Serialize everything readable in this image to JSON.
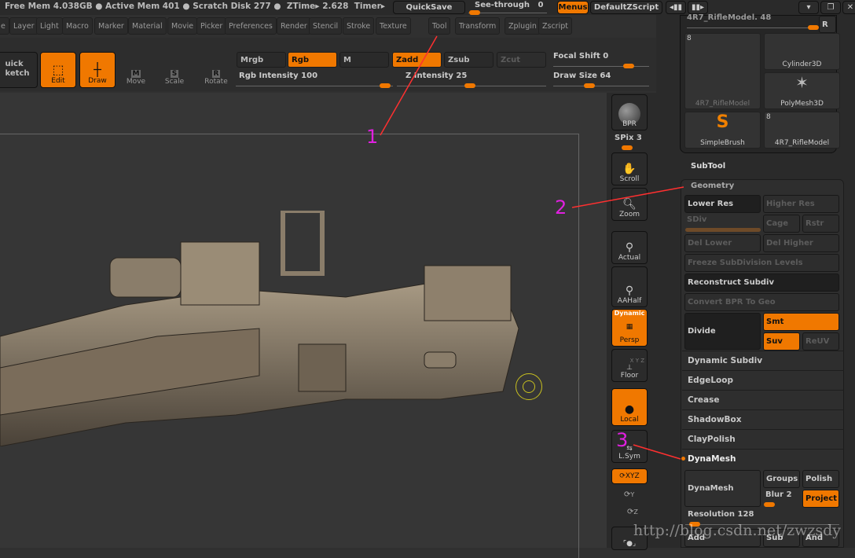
{
  "topbar": {
    "status": "Free Mem 4.038GB ● Active Mem 401 ● Scratch Disk 277 ●  ZTime▸ 2.628  Timer▸",
    "quicksave": "QuickSave",
    "see_through_label": "See-through",
    "see_through_value": "0",
    "menus": "Menus",
    "default_zscript": "DefaultZScript"
  },
  "menus": [
    "e",
    "Layer",
    "Light",
    "Macro",
    "Marker",
    "Material",
    "Movie",
    "Picker",
    "Preferences",
    "Render",
    "Stencil",
    "Stroke",
    "Texture",
    "Tool",
    "Transform",
    "Zplugin",
    "Zscript"
  ],
  "toolbar": {
    "quick_sketch": "uick\nketch",
    "edit": "Edit",
    "draw": "Draw",
    "move": "Move",
    "scale": "Scale",
    "rotate": "Rotate",
    "mrgb": "Mrgb",
    "rgb": "Rgb",
    "m": "M",
    "zadd": "Zadd",
    "zsub": "Zsub",
    "zcut": "Zcut",
    "rgb_intensity": "Rgb Intensity 100",
    "z_intensity": "Z Intensity 25",
    "focal_shift": "Focal Shift 0",
    "draw_size": "Draw Size 64",
    "rgb_intensity_value": 100,
    "z_intensity_value": 25,
    "draw_size_value": 64
  },
  "shelf": {
    "bpr": "BPR",
    "spix": "SPix 3",
    "scroll": "Scroll",
    "zoom": "Zoom",
    "actual": "Actual",
    "aahalf": "AAHalf",
    "dynamic": "Dynamic",
    "persp": "Persp",
    "floor": "Floor",
    "floor_axes": "X Y Z",
    "local": "Local",
    "lsym": "L.Sym",
    "xyz": "XYZ",
    "y": "Y",
    "z": "Z"
  },
  "tool_panel": {
    "model_slider": "4R7_RifleModel. 48",
    "r": "R",
    "thumbs": [
      {
        "label": "4R7_RifleModel",
        "badge": "8"
      },
      {
        "label": "Cylinder3D"
      },
      {
        "label": "PolyMesh3D"
      },
      {
        "label": "SimpleBrush"
      },
      {
        "label": "4R7_RifleModel",
        "badge": "8"
      }
    ]
  },
  "subtool": "SubTool",
  "geometry": {
    "title": "Geometry",
    "lower_res": "Lower Res",
    "higher_res": "Higher Res",
    "sdiv": "SDiv",
    "cage": "Cage",
    "rstr": "Rstr",
    "del_lower": "Del Lower",
    "del_higher": "Del Higher",
    "freeze": "Freeze SubDivision Levels",
    "reconstruct": "Reconstruct Subdiv",
    "convert_bpr": "Convert BPR To Geo",
    "divide": "Divide",
    "smt": "Smt",
    "suv": "Suv",
    "reuv": "ReUV"
  },
  "sections": [
    "Dynamic Subdiv",
    "EdgeLoop",
    "Crease",
    "ShadowBox",
    "ClayPolish"
  ],
  "dynamesh": {
    "title": "DynaMesh",
    "button": "DynaMesh",
    "groups": "Groups",
    "polish": "Polish",
    "blur": "Blur 2",
    "project": "Project",
    "resolution": "Resolution 128",
    "resolution_value": 128,
    "add": "Add",
    "sub": "Sub",
    "and": "And"
  },
  "annotations": [
    "1",
    "2",
    "3"
  ],
  "watermark": "http://blog.csdn.net/zwzsdy",
  "colors": {
    "accent": "#f07800",
    "annotation": "#e020e0",
    "arrow": "#ff3030"
  }
}
